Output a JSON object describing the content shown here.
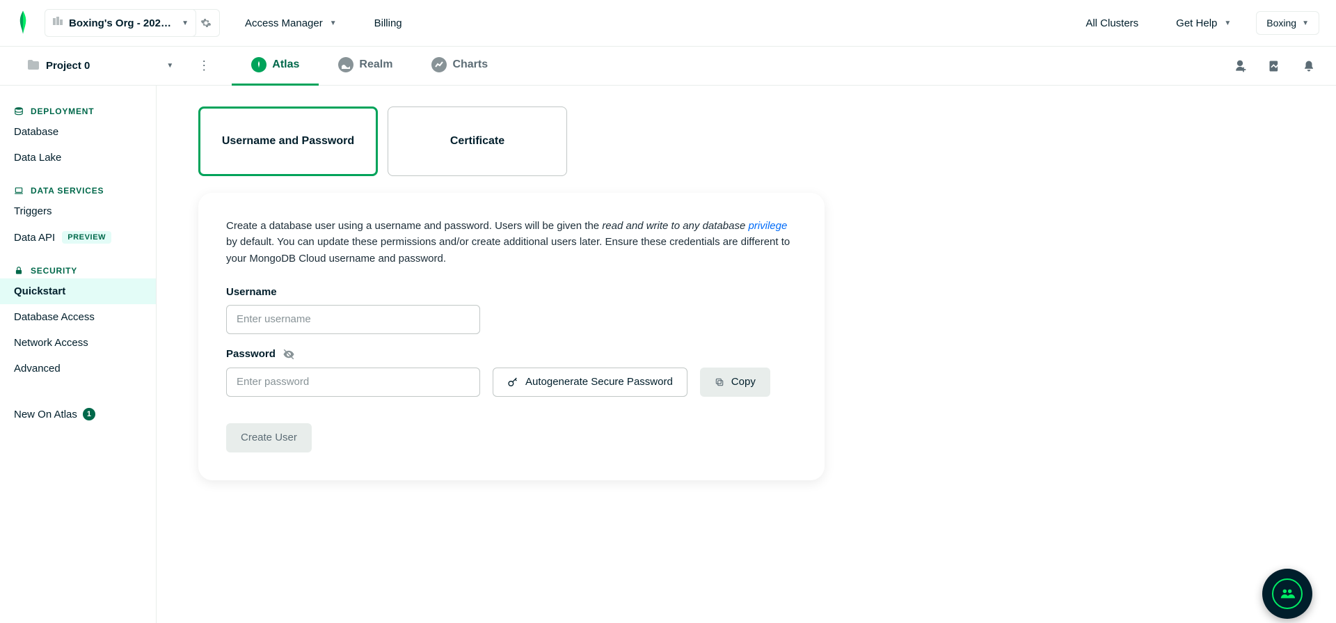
{
  "top": {
    "org_name": "Boxing's Org - 2022-…",
    "access_manager": "Access Manager",
    "billing": "Billing",
    "all_clusters": "All Clusters",
    "get_help": "Get Help",
    "user": "Boxing"
  },
  "sub": {
    "project_name": "Project 0",
    "tabs": {
      "atlas": "Atlas",
      "realm": "Realm",
      "charts": "Charts"
    }
  },
  "sidebar": {
    "sections": {
      "deployment": "DEPLOYMENT",
      "data_services": "DATA SERVICES",
      "security": "SECURITY"
    },
    "items": {
      "database": "Database",
      "data_lake": "Data Lake",
      "triggers": "Triggers",
      "data_api": "Data API",
      "data_api_badge": "PREVIEW",
      "quickstart": "Quickstart",
      "database_access": "Database Access",
      "network_access": "Network Access",
      "advanced": "Advanced",
      "new_on_atlas": "New On Atlas",
      "new_count": "1"
    }
  },
  "auth": {
    "option_userpass": "Username and Password",
    "option_cert": "Certificate"
  },
  "panel": {
    "desc_1": "Create a database user using a username and password. Users will be given the ",
    "desc_italic": "read and write to any database ",
    "desc_link": "privilege",
    "desc_2": " by default. You can update these permissions and/or create additional users later. Ensure these credentials are different to your MongoDB Cloud username and password.",
    "username_label": "Username",
    "username_placeholder": "Enter username",
    "password_label": "Password",
    "password_placeholder": "Enter password",
    "autogen_label": "Autogenerate Secure Password",
    "copy_label": "Copy",
    "create_user": "Create User"
  }
}
